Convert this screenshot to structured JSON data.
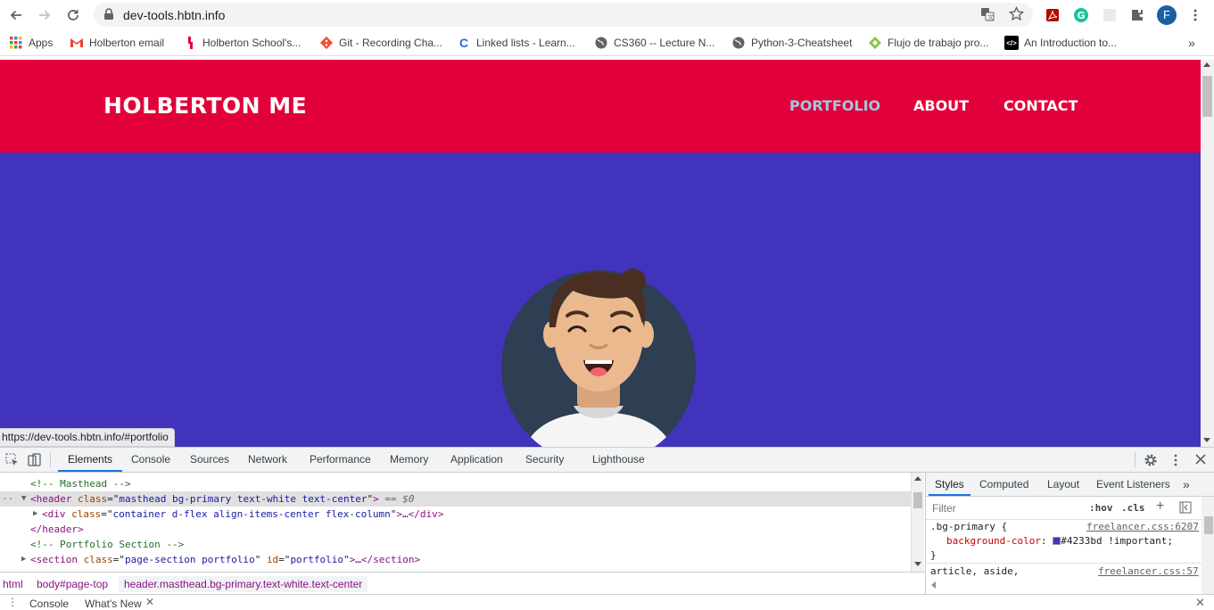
{
  "browser": {
    "url": "dev-tools.hbtn.info",
    "profile_initial": "F",
    "status_url": "https://dev-tools.hbtn.info/#portfolio"
  },
  "bookmarks": [
    {
      "label": "Apps",
      "icon": "apps-grid-icon",
      "color": "#ea4335"
    },
    {
      "label": "Holberton email",
      "icon": "gmail-icon",
      "color": "#ea4335"
    },
    {
      "label": "Holberton School's...",
      "icon": "holberton-icon",
      "color": "#e2003b"
    },
    {
      "label": "Git - Recording Cha...",
      "icon": "git-icon",
      "color": "#f05033"
    },
    {
      "label": "Linked lists - Learn...",
      "icon": "learn-c-icon",
      "color": "#3367d6"
    },
    {
      "label": "CS360 -- Lecture N...",
      "icon": "globe-icon",
      "color": "#5f6368"
    },
    {
      "label": "Python-3-Cheatsheet",
      "icon": "globe-icon",
      "color": "#5f6368"
    },
    {
      "label": "Flujo de trabajo pro...",
      "icon": "diamond-icon",
      "color": "#8bc34a"
    },
    {
      "label": "An Introduction to...",
      "icon": "code-icon",
      "color": "#000000"
    }
  ],
  "site": {
    "brand": "HOLBERTON ME",
    "nav": [
      "PORTFOLIO",
      "ABOUT",
      "CONTACT"
    ],
    "nav_bg": "#e2003b",
    "masthead_bg": "#4233bd"
  },
  "devtools": {
    "tabs": [
      "Elements",
      "Console",
      "Sources",
      "Network",
      "Performance",
      "Memory",
      "Application",
      "Security",
      "Lighthouse"
    ],
    "dom": {
      "comment_masthead": "<!-- Masthead -->",
      "header_open_tag": "header",
      "header_class_attr": "class",
      "header_class_val": "masthead bg-primary text-white text-center",
      "eq0": "== $0",
      "div_tag": "div",
      "div_class_val": "container d-flex align-items-center flex-column",
      "header_close": "</header>",
      "comment_portfolio": "<!-- Portfolio Section -->",
      "section_tag": "section",
      "section_class_val": "page-section portfolio",
      "section_id_attr": "id",
      "section_id_val": "portfolio",
      "section_close": "</section>",
      "ellipsis": "…"
    },
    "breadcrumbs": [
      "html",
      "body#page-top",
      "header.masthead.bg-primary.text-white.text-center"
    ],
    "styles_tabs": [
      "Styles",
      "Computed",
      "Layout",
      "Event Listeners"
    ],
    "filter_placeholder": "Filter",
    "hov": ":hov",
    "cls": ".cls",
    "rule1_selector": ".bg-primary {",
    "rule1_source": "freelancer.css:6207",
    "rule1_property": "background-color",
    "rule1_value": "#4233bd !important;",
    "rule1_close": "}",
    "rule2_selector": "article, aside,",
    "rule2_source": "freelancer.css:57",
    "drawer_tabs": [
      "Console",
      "What's New"
    ]
  }
}
